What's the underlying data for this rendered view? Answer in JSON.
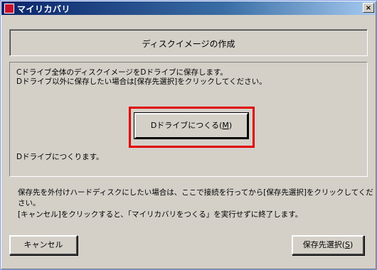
{
  "window": {
    "title": "マイリカバリ",
    "close_label": "×"
  },
  "header": {
    "title": "ディスクイメージの作成"
  },
  "main": {
    "desc_line1": "Cドライブ全体のディスクイメージをDドライブに保存します。",
    "desc_line2": "Dドライブ以外に保存したい場合は[保存先選択]をクリックしてください。",
    "make_button_prefix": "Dドライブにつくる(",
    "make_button_key": "M",
    "make_button_suffix": ")",
    "status": "Dドライブにつくります。",
    "highlight_color": "#e00000"
  },
  "notes": {
    "line1": "保存先を外付けハードディスクにしたい場合は、ここで接続を行ってから[保存先選択]をクリックしてください。",
    "line2": "[キャンセル]をクリックすると、「マイリカバリをつくる」を実行せずに終了します。"
  },
  "footer": {
    "cancel_label": "キャンセル",
    "save_prefix": "保存先選択(",
    "save_key": "S",
    "save_suffix": ")"
  }
}
